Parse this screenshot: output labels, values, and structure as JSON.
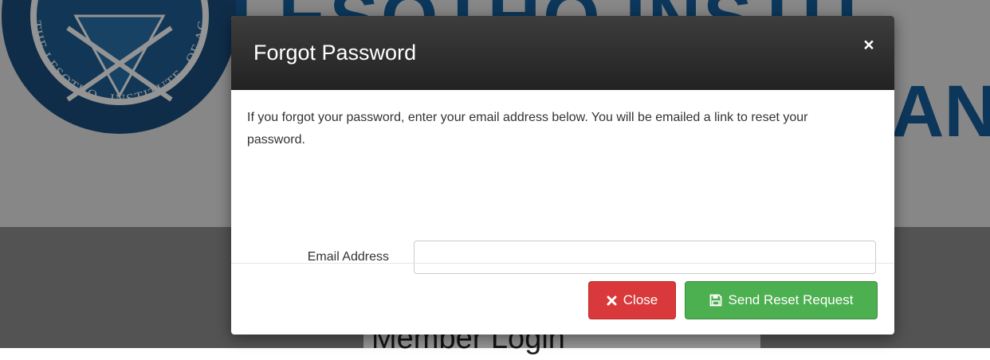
{
  "background": {
    "brand_line1": "LESOTHO INSTIT",
    "brand_line2": "AN",
    "seal_text_left": "THE LESOTHO",
    "seal_text_bottom": "INSTITUTE",
    "seal_text_right": "OF ACCOUNTANTS",
    "member_login_title": "Member Login"
  },
  "modal": {
    "title": "Forgot Password",
    "close_symbol": "×",
    "help_text": "If you forgot your password, enter your email address below. You will be emailed a link to reset your password.",
    "email_label": "Email Address",
    "email_value": "",
    "email_placeholder": "",
    "buttons": {
      "close_label": "Close",
      "close_icon": "times-icon",
      "send_label": "Send Reset Request",
      "send_icon": "floppy-disk-icon"
    }
  },
  "colors": {
    "header_dark": "#222222",
    "danger": "#d9393a",
    "success": "#4caf50",
    "brand_blue": "#15609b"
  }
}
